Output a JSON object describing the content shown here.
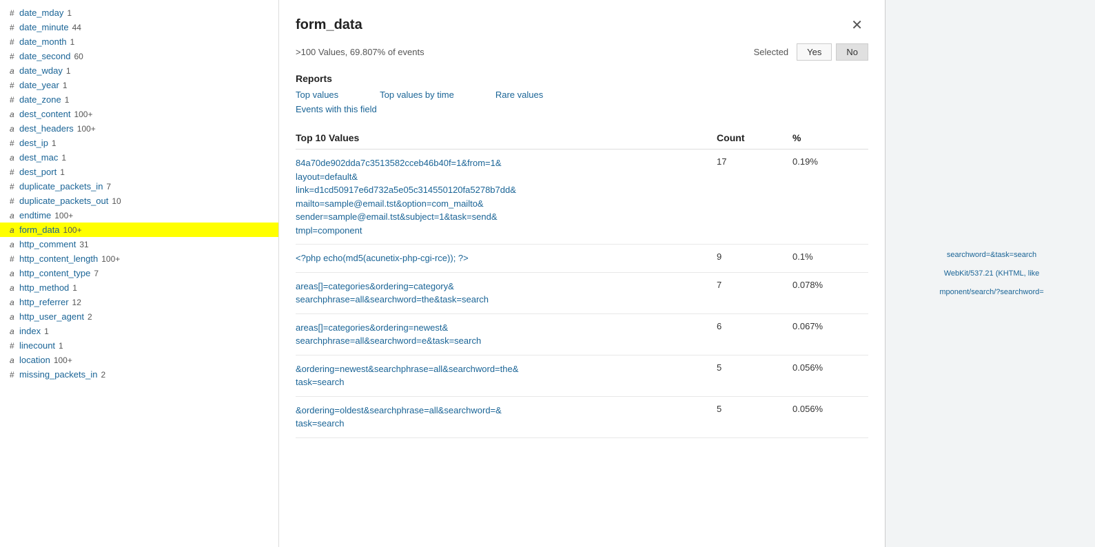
{
  "sidebar": {
    "items": [
      {
        "id": "date_mday",
        "icon": "#",
        "type": "hash",
        "name": "date_mday",
        "count": "1"
      },
      {
        "id": "date_minute",
        "icon": "#",
        "type": "hash",
        "name": "date_minute",
        "count": "44"
      },
      {
        "id": "date_month",
        "icon": "#",
        "type": "hash",
        "name": "date_month",
        "count": "1"
      },
      {
        "id": "date_second",
        "icon": "#",
        "type": "hash",
        "name": "date_second",
        "count": "60"
      },
      {
        "id": "date_wday",
        "icon": "a",
        "type": "alpha",
        "name": "date_wday",
        "count": "1"
      },
      {
        "id": "date_year",
        "icon": "#",
        "type": "hash",
        "name": "date_year",
        "count": "1"
      },
      {
        "id": "date_zone",
        "icon": "#",
        "type": "hash",
        "name": "date_zone",
        "count": "1"
      },
      {
        "id": "dest_content",
        "icon": "a",
        "type": "alpha",
        "name": "dest_content",
        "count": "100+"
      },
      {
        "id": "dest_headers",
        "icon": "a",
        "type": "alpha",
        "name": "dest_headers",
        "count": "100+"
      },
      {
        "id": "dest_ip",
        "icon": "#",
        "type": "hash",
        "name": "dest_ip",
        "count": "1"
      },
      {
        "id": "dest_mac",
        "icon": "a",
        "type": "alpha",
        "name": "dest_mac",
        "count": "1"
      },
      {
        "id": "dest_port",
        "icon": "#",
        "type": "hash",
        "name": "dest_port",
        "count": "1"
      },
      {
        "id": "duplicate_packets_in",
        "icon": "#",
        "type": "hash",
        "name": "duplicate_packets_in",
        "count": "7"
      },
      {
        "id": "duplicate_packets_out",
        "icon": "#",
        "type": "hash",
        "name": "duplicate_packets_out",
        "count": "10"
      },
      {
        "id": "endtime",
        "icon": "a",
        "type": "alpha",
        "name": "endtime",
        "count": "100+"
      },
      {
        "id": "form_data",
        "icon": "a",
        "type": "alpha",
        "name": "form_data",
        "count": "100+",
        "highlighted": true
      },
      {
        "id": "http_comment",
        "icon": "a",
        "type": "alpha",
        "name": "http_comment",
        "count": "31"
      },
      {
        "id": "http_content_length",
        "icon": "#",
        "type": "hash",
        "name": "http_content_length",
        "count": "100+"
      },
      {
        "id": "http_content_type",
        "icon": "a",
        "type": "alpha",
        "name": "http_content_type",
        "count": "7"
      },
      {
        "id": "http_method",
        "icon": "a",
        "type": "alpha",
        "name": "http_method",
        "count": "1"
      },
      {
        "id": "http_referrer",
        "icon": "a",
        "type": "alpha",
        "name": "http_referrer",
        "count": "12"
      },
      {
        "id": "http_user_agent",
        "icon": "a",
        "type": "alpha",
        "name": "http_user_agent",
        "count": "2"
      },
      {
        "id": "index",
        "icon": "a",
        "type": "alpha",
        "name": "index",
        "count": "1"
      },
      {
        "id": "linecount",
        "icon": "#",
        "type": "hash",
        "name": "linecount",
        "count": "1"
      },
      {
        "id": "location",
        "icon": "a",
        "type": "alpha",
        "name": "location",
        "count": "100+"
      },
      {
        "id": "missing_packets_in",
        "icon": "#",
        "type": "hash",
        "name": "missing_packets_in",
        "count": "2"
      }
    ]
  },
  "panel": {
    "title": "form_data",
    "subtitle": ">100 Values, 69.807% of events",
    "selected_label": "Selected",
    "btn_yes": "Yes",
    "btn_no": "No",
    "reports_heading": "Reports",
    "report_links": [
      {
        "id": "top-values",
        "label": "Top values"
      },
      {
        "id": "top-values-by-time",
        "label": "Top values by time"
      },
      {
        "id": "rare-values",
        "label": "Rare values"
      }
    ],
    "events_link": "Events with this field",
    "table": {
      "heading": "Top 10 Values",
      "col_count": "Count",
      "col_pct": "%",
      "rows": [
        {
          "value": "84a70de902dda7c3513582cceb46b40f=1&from=1&\nlayout=default&\nlink=d1cd50917e6d732a5e05c314550120fa5278b7dd&\nmailto=sample@email.tst&option=com_mailto&\nsender=sample@email.tst&subject=1&task=send&\ntmpl=component",
          "count": "17",
          "pct": "0.19%"
        },
        {
          "value": "<?php echo(md5(acunetix-php-cgi-rce)); ?>",
          "count": "9",
          "pct": "0.1%"
        },
        {
          "value": "areas[]=categories&ordering=category&\nsearchphrase=all&searchword=the&task=search",
          "count": "7",
          "pct": "0.078%"
        },
        {
          "value": "areas[]=categories&ordering=newest&\nsearchphrase=all&searchword=e&task=search",
          "count": "6",
          "pct": "0.067%"
        },
        {
          "value": "&ordering=newest&searchphrase=all&searchword=the&\ntask=search",
          "count": "5",
          "pct": "0.056%"
        },
        {
          "value": "&ordering=oldest&searchphrase=all&searchword=&\ntask=search",
          "count": "5",
          "pct": "0.056%"
        }
      ]
    }
  },
  "right_area": {
    "text1": "searchword=&task=search",
    "text2": "WebKit/537.21 (KHTML, like",
    "text3": "mponent/search/?searchword="
  }
}
